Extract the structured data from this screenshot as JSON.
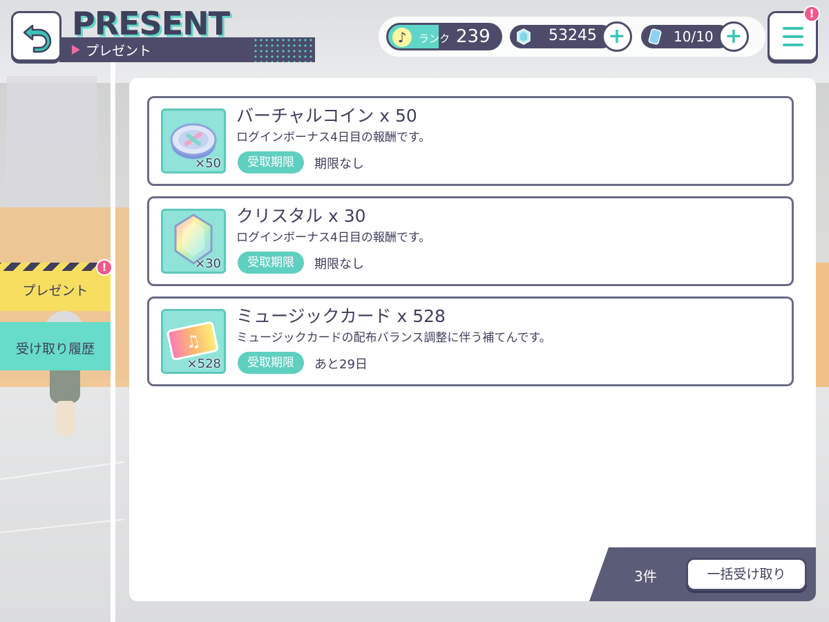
{
  "header": {
    "title_en": "PRESENT",
    "title_jp": "プレゼント"
  },
  "status": {
    "rank_label": "ランク",
    "rank_value": "239",
    "rank_progress_percent": 45,
    "crystals": "53245",
    "stamina": "10/10"
  },
  "sidebar": {
    "tabs": [
      {
        "label": "プレゼント",
        "active": true
      },
      {
        "label": "受け取り履歴",
        "active": false
      }
    ]
  },
  "presents": [
    {
      "name": "バーチャルコイン x 50",
      "desc": "ログインボーナス4日目の報酬です。",
      "qty": "×50",
      "badge": "受取期限",
      "limit": "期限なし",
      "icon": "virtual-coin-icon"
    },
    {
      "name": "クリスタル x 30",
      "desc": "ログインボーナス4日目の報酬です。",
      "qty": "×30",
      "badge": "受取期限",
      "limit": "期限なし",
      "icon": "crystal-icon"
    },
    {
      "name": "ミュージックカード x 528",
      "desc": "ミュージックカードの配布バランス調整に伴う補てんです。",
      "qty": "×528",
      "badge": "受取期限",
      "limit": "あと29日",
      "icon": "music-card-icon"
    }
  ],
  "footer": {
    "count": "3件",
    "receive_all_label": "一括受け取り"
  },
  "colors": {
    "navy": "#4c4c6a",
    "teal": "#5fd6c8",
    "yellow_tab": "#f7de60",
    "alert_pink": "#f0588a"
  }
}
